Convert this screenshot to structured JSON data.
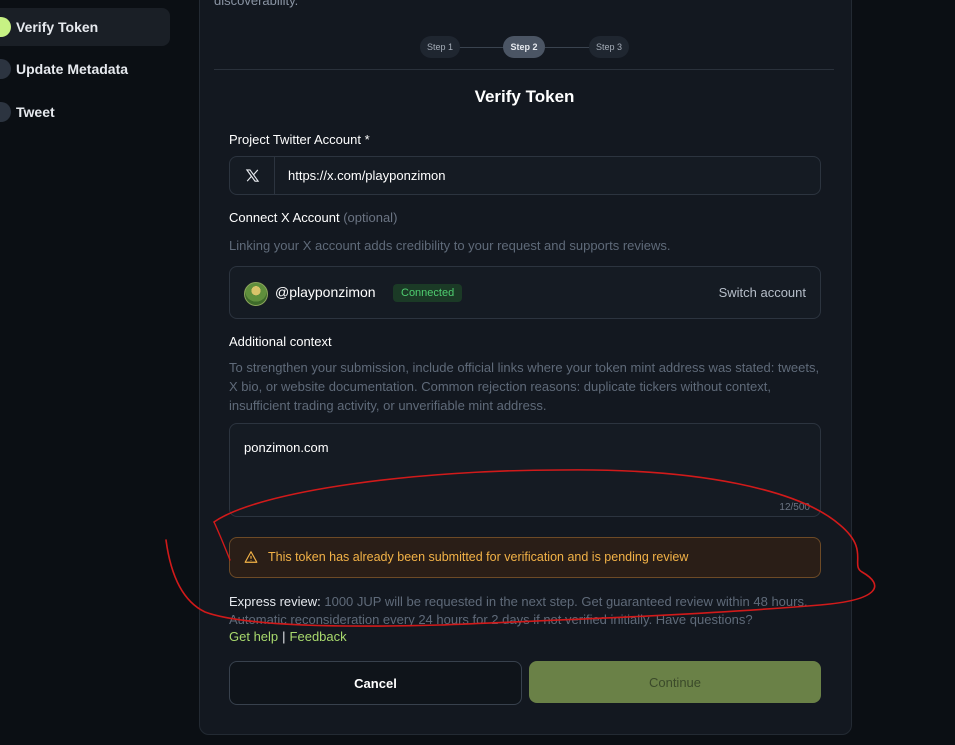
{
  "sidebar": {
    "items": [
      {
        "label": "Verify Token",
        "active": true
      },
      {
        "label": "Update Metadata",
        "active": false
      },
      {
        "label": "Tweet",
        "active": false
      }
    ]
  },
  "header": {
    "top_text": "discoverability.",
    "steps": [
      "Step 1",
      "Step 2",
      "Step 3"
    ],
    "active_step": 2
  },
  "form": {
    "title": "Verify Token",
    "twitter": {
      "label": "Project Twitter Account *",
      "icon": "x-logo-icon",
      "value": "https://x.com/playponzimon"
    },
    "connect": {
      "label": "Connect X Account",
      "optional": "(optional)",
      "help": "Linking your X account adds credibility to your request and supports reviews.",
      "handle": "@playponzimon",
      "status": "Connected",
      "switch_label": "Switch account"
    },
    "context": {
      "label": "Additional context",
      "help": "To strengthen your submission, include official links where your token mint address was stated: tweets, X bio, or website documentation. Common rejection reasons: duplicate tickers without context, insufficient trading activity, or unverifiable mint address.",
      "value": "ponzimon.com",
      "counter": "12/500"
    },
    "alert": {
      "icon": "warning-icon",
      "text": "This token has already been submitted for verification and is pending review"
    },
    "express": {
      "label": "Express review:",
      "text": " 1000 JUP will be requested in the next step. Get guaranteed review within 48 hours. Automatic reconsideration every 24 hours for 2 days if not verified initially. Have questions?"
    },
    "links": {
      "help": "Get help",
      "separator": "|",
      "feedback": "Feedback"
    },
    "buttons": {
      "cancel": "Cancel",
      "continue": "Continue"
    }
  },
  "colors": {
    "accent": "#c7f284",
    "connected": "#4fce70",
    "warning": "#f2b247",
    "continue_bg": "#6a8147",
    "annotation": "#d11a1a"
  }
}
